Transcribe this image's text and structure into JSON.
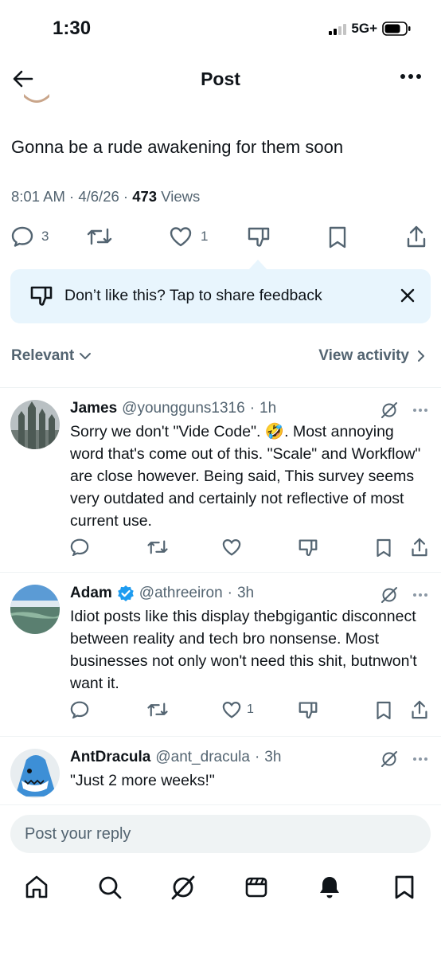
{
  "status_bar": {
    "time": "1:30",
    "network": "5G+"
  },
  "header": {
    "title": "Post"
  },
  "post": {
    "text": "Gonna be a rude awakening for them soon",
    "time": "8:01 AM",
    "date": "4/6/26",
    "views_count": "473",
    "views_label": "Views",
    "replies": "3",
    "likes": "1"
  },
  "feedback": {
    "text": "Don’t like this? Tap to share feedback"
  },
  "sort": {
    "selected": "Relevant",
    "view_activity": "View activity"
  },
  "replies": [
    {
      "name": "James",
      "handle": "@youngguns1316",
      "time": "1h",
      "verified": false,
      "text": "Sorry we don't \"Vide Code\". 🤣. Most annoying word that's come out of this. \"Scale\" and Workflow\" are close however. Being said, This survey seems very outdated and certainly not reflective of most current use.",
      "likes": ""
    },
    {
      "name": "Adam",
      "handle": "@athreeiron",
      "time": "3h",
      "verified": true,
      "text": "Idiot posts like this display thebgigantic disconnect between reality and tech bro nonsense. Most businesses not only won't need this shit, butnwon't want it.",
      "likes": "1"
    },
    {
      "name": "AntDracula",
      "handle": "@ant_dracula",
      "time": "3h",
      "verified": false,
      "text": "\"Just 2 more weeks!\"",
      "likes": ""
    }
  ],
  "reply_bar": {
    "placeholder": "Post your reply"
  },
  "colors": {
    "accent": "#1d9bf0",
    "feedback_bg": "#e8f5fd",
    "secondary_text": "#536471",
    "verified": "#1d9bf0"
  },
  "icons": {
    "nav": [
      "home-icon",
      "search-icon",
      "grok-icon",
      "video-icon",
      "notifications-icon",
      "bookmarks-icon"
    ]
  }
}
